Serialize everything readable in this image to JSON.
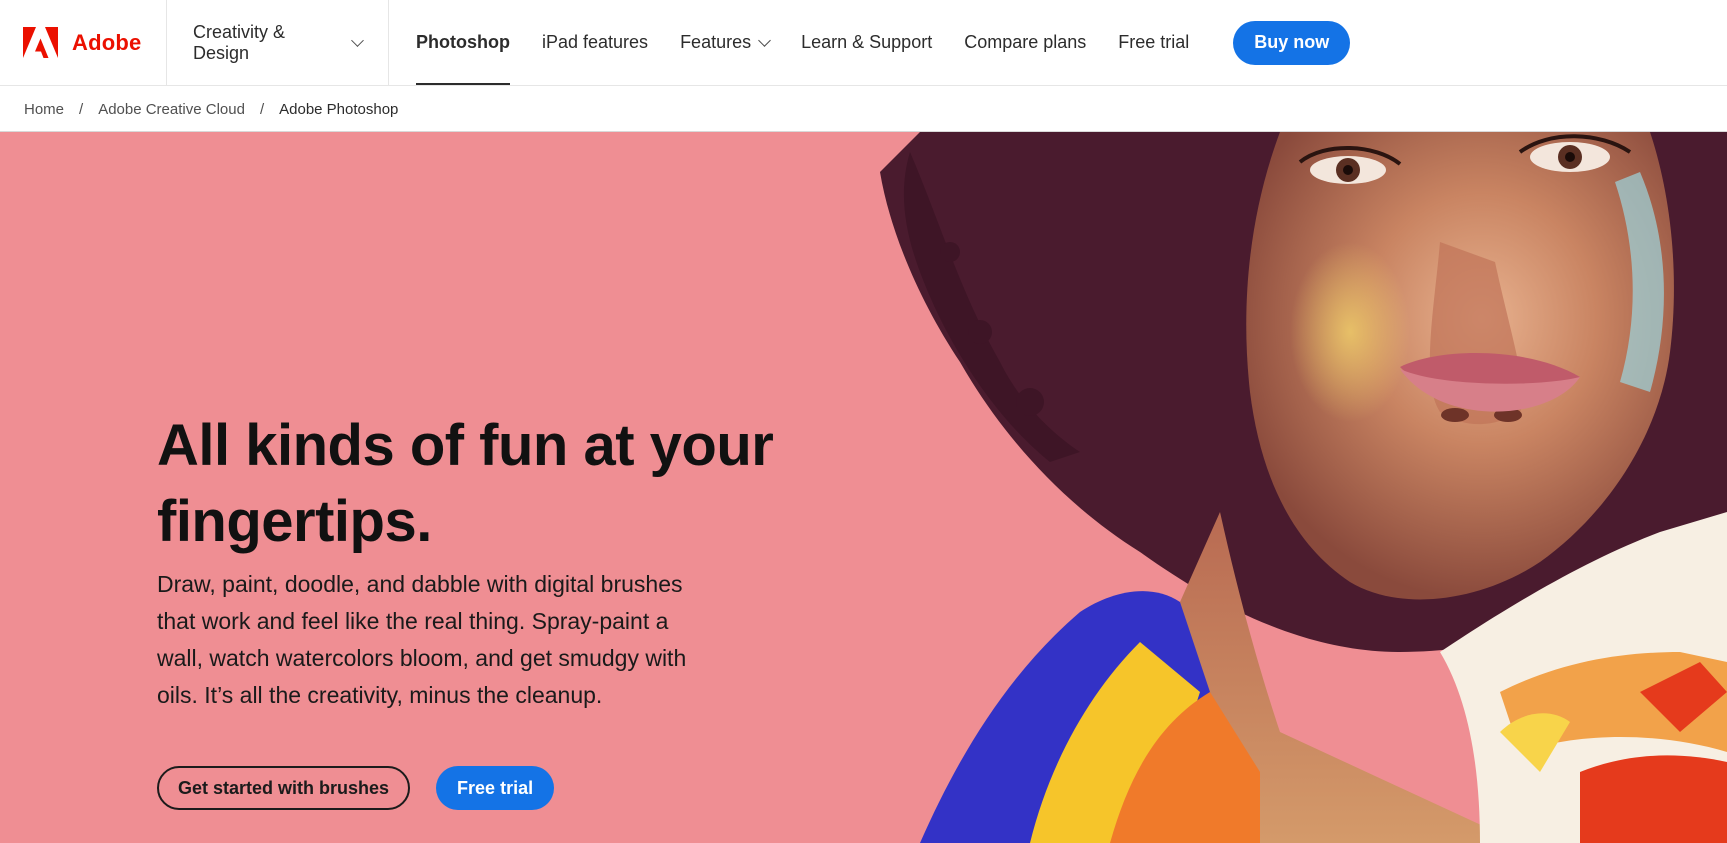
{
  "brand": {
    "name": "Adobe",
    "logo_icon": "adobe-logo-icon",
    "color": "#eb1000"
  },
  "nav": {
    "creativity_menu": "Creativity & Design",
    "links": [
      {
        "label": "Photoshop",
        "active": true
      },
      {
        "label": "iPad features"
      },
      {
        "label": "Features",
        "dropdown": true
      },
      {
        "label": "Learn & Support"
      },
      {
        "label": "Compare plans"
      },
      {
        "label": "Free trial"
      }
    ],
    "buy_label": "Buy now"
  },
  "breadcrumb": [
    "Home",
    "Adobe Creative Cloud",
    "Adobe Photoshop"
  ],
  "hero": {
    "headline": "All kinds of fun at your fingertips.",
    "body": "Draw, paint, doodle, and dabble with digital brushes that work and feel like the real thing. Spray-paint a wall, watch watercolors bloom, and get smudgy with oils. It’s all the creativity, minus the cleanup.",
    "cta_secondary": "Get started with brushes",
    "cta_primary": "Free trial",
    "background_color": "#ef8e93",
    "accent_color": "#1473e6"
  }
}
